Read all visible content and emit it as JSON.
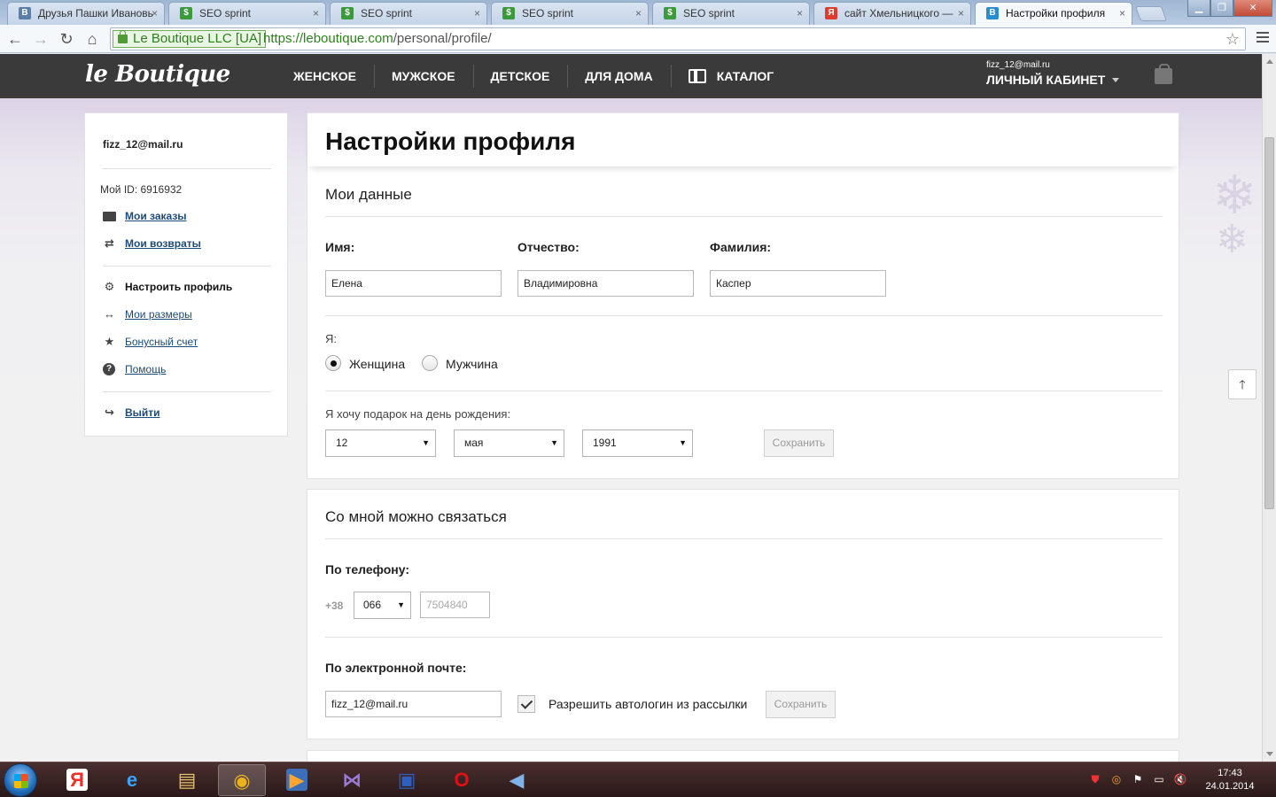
{
  "browser": {
    "tabs": [
      {
        "title": "Друзья Пашки Ивановь",
        "favicon": "vk-icon",
        "fav_color": "#5b7fa6",
        "fav_text": "B"
      },
      {
        "title": "SEO sprint",
        "favicon": "seosprint-icon",
        "fav_color": "#3c9a3c",
        "fav_text": "$"
      },
      {
        "title": "SEO sprint",
        "favicon": "seosprint-icon",
        "fav_color": "#3c9a3c",
        "fav_text": "$"
      },
      {
        "title": "SEO sprint",
        "favicon": "seosprint-icon",
        "fav_color": "#3c9a3c",
        "fav_text": "$"
      },
      {
        "title": "SEO sprint",
        "favicon": "seosprint-icon",
        "fav_color": "#3c9a3c",
        "fav_text": "$"
      },
      {
        "title": "сайт Хмельницкого —",
        "favicon": "yandex-icon",
        "fav_color": "#e03b2f",
        "fav_text": "Я"
      },
      {
        "title": "Настройки профиля",
        "favicon": "leboutique-icon",
        "fav_color": "#2a8cd0",
        "fav_text": "B"
      }
    ],
    "ev_label": "Le Boutique LLC [UA]",
    "url_scheme_host": "https://leboutique.com",
    "url_path": "/personal/profile/"
  },
  "site": {
    "logo": "le Boutique",
    "nav": [
      "ЖЕНСКОЕ",
      "МУЖСКОЕ",
      "ДЕТСКОЕ",
      "ДЛЯ ДОМА",
      "КАТАЛОГ"
    ],
    "account_email": "fizz_12@mail.ru",
    "account_label": "ЛИЧНЫЙ КАБИНЕТ"
  },
  "sidebar": {
    "email": "fizz_12@mail.ru",
    "my_id": "Мой ID: 6916932",
    "items": [
      {
        "label": "Мои заказы",
        "icon": "bag-icon"
      },
      {
        "label": "Мои возвраты",
        "icon": "swap-arrows-icon"
      },
      {
        "label": "Настроить профиль",
        "icon": "gear-icon"
      },
      {
        "label": "Мои размеры",
        "icon": "double-arrow-icon"
      },
      {
        "label": "Бонусный счет",
        "icon": "star-icon"
      },
      {
        "label": "Помощь",
        "icon": "help-icon"
      },
      {
        "label": "Выйти",
        "icon": "logout-icon"
      }
    ]
  },
  "profile": {
    "page_title": "Настройки профиля",
    "section_my_data": "Мои данные",
    "first_name_label": "Имя:",
    "first_name": "Елена",
    "patronymic_label": "Отчество:",
    "patronymic": "Владимировна",
    "last_name_label": "Фамилия:",
    "last_name": "Каспер",
    "gender_label": "Я:",
    "gender_female": "Женщина",
    "gender_male": "Мужчина",
    "birthday_label": "Я хочу подарок на день рождения:",
    "birth_day": "12",
    "birth_month": "мая",
    "birth_year": "1991",
    "save": "Сохранить"
  },
  "contacts": {
    "section_title": "Со мной можно связаться",
    "phone_label": "По телефону:",
    "phone_prefix": "+38",
    "phone_code": "066",
    "phone_number_placeholder": "7504840",
    "email_label": "По электронной почте:",
    "email": "fizz_12@mail.ru",
    "autologin_label": "Разрешить автологин из рассылки",
    "save": "Сохранить"
  },
  "taskbar": {
    "time": "17:43",
    "date": "24.01.2014",
    "apps": [
      {
        "name": "yandex-browser-icon",
        "glyph": "Я",
        "color": "#e8322b",
        "bg": "#ffffff"
      },
      {
        "name": "internet-explorer-icon",
        "glyph": "e",
        "color": "#3aa3ff",
        "bg": "transparent"
      },
      {
        "name": "file-explorer-icon",
        "glyph": "▤",
        "color": "#e7c46a",
        "bg": "transparent"
      },
      {
        "name": "chrome-icon",
        "glyph": "◉",
        "color": "#e9b41c",
        "bg": "transparent"
      },
      {
        "name": "media-player-icon",
        "glyph": "▶",
        "color": "#ffa530",
        "bg": "#3d6fb8"
      },
      {
        "name": "visual-studio-icon",
        "glyph": "⋈",
        "color": "#9a7ad8",
        "bg": "transparent"
      },
      {
        "name": "floppy-save-icon",
        "glyph": "▣",
        "color": "#2f5fbf",
        "bg": "transparent"
      },
      {
        "name": "opera-icon",
        "glyph": "O",
        "color": "#e01010",
        "bg": "transparent"
      },
      {
        "name": "sound-recorder-icon",
        "glyph": "◀",
        "color": "#7fb3ea",
        "bg": "transparent"
      }
    ]
  }
}
